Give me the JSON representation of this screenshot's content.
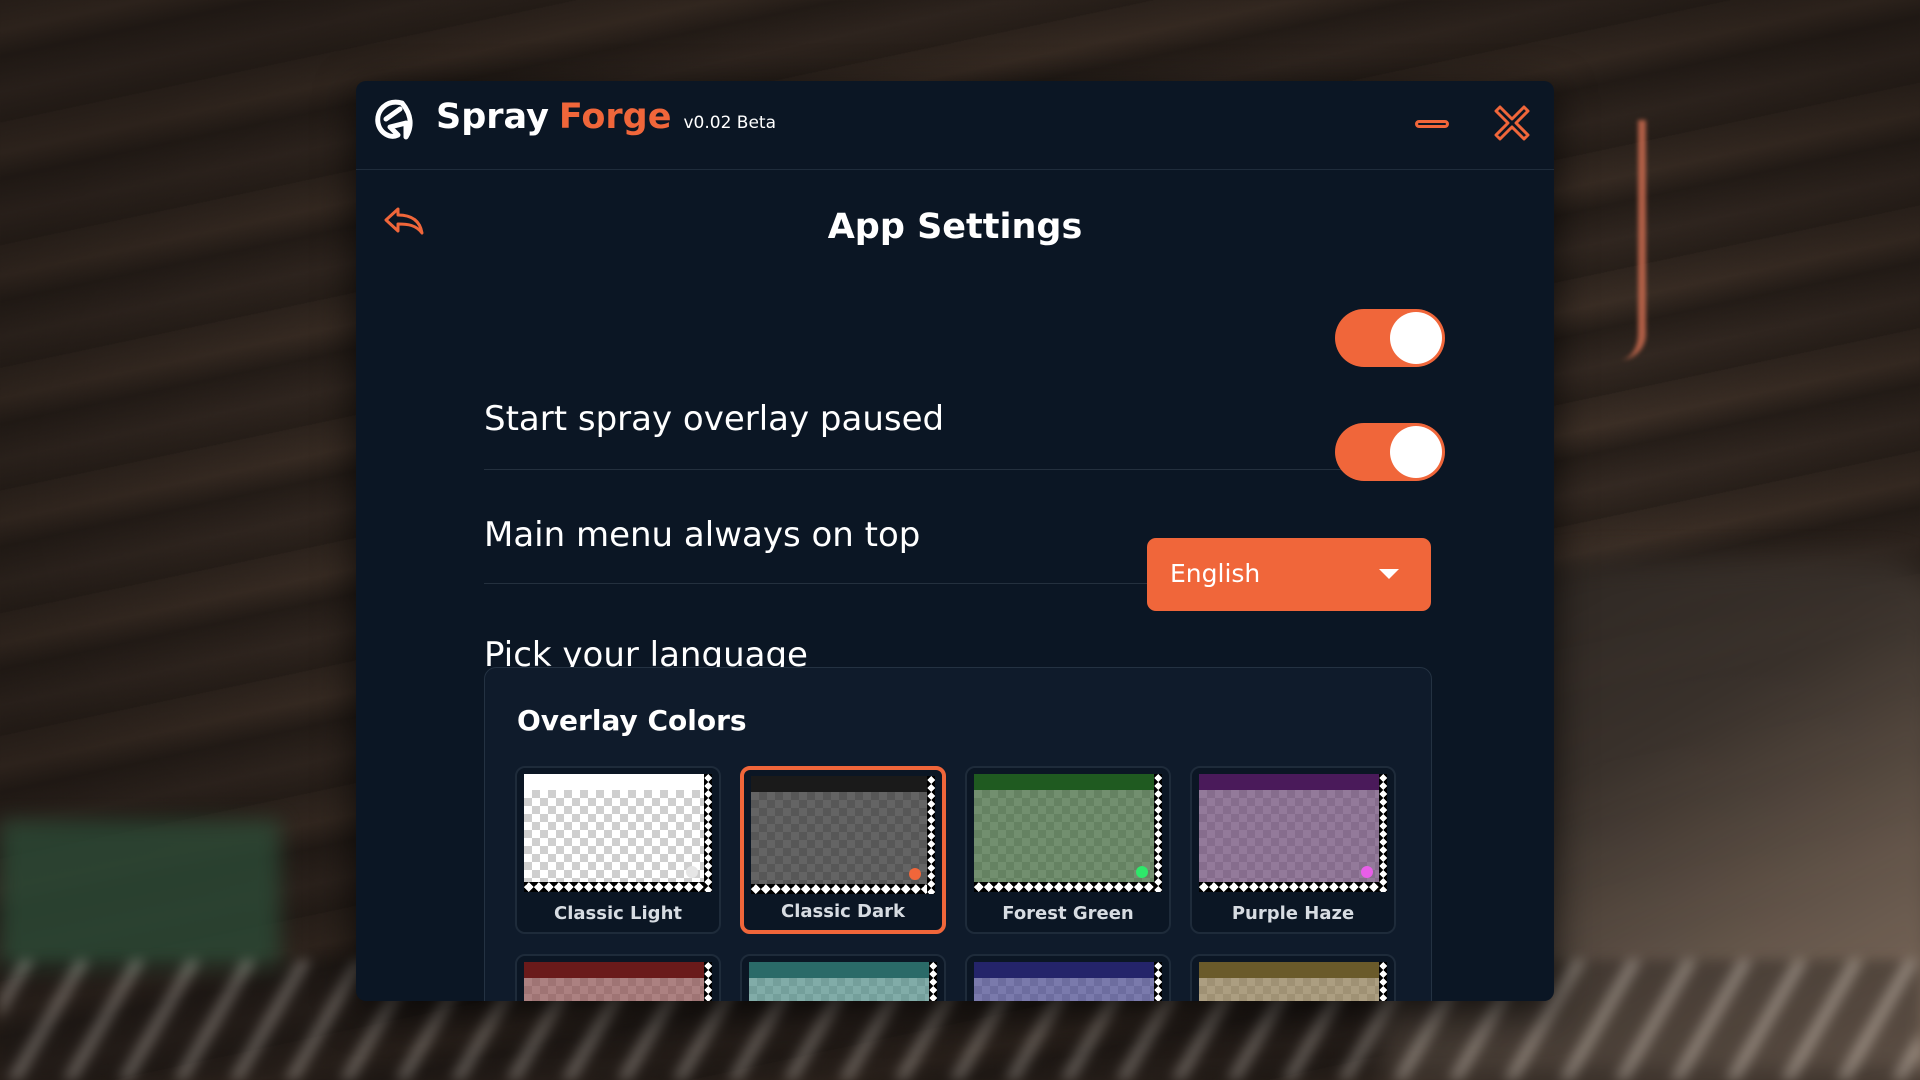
{
  "app": {
    "name_part1": "Spray",
    "name_part2": "Forge",
    "version": "v0.02 Beta",
    "accent_color": "#f0663a",
    "background_color": "#0b1624"
  },
  "window_controls": {
    "minimize_icon": "minimize-icon",
    "close_icon": "close-icon"
  },
  "page": {
    "title": "App Settings",
    "back_icon": "back-arrow-icon"
  },
  "settings": {
    "start_paused": {
      "label": "Start spray overlay paused",
      "enabled": true
    },
    "always_on_top": {
      "label": "Main menu always on top",
      "enabled": true
    },
    "language": {
      "label": "Pick your language",
      "selected": "English"
    }
  },
  "overlay_colors": {
    "title": "Overlay Colors",
    "selected": "Classic Dark",
    "swatches": [
      {
        "name": "Classic Light",
        "bar": "#ffffff",
        "tint": "rgba(255,255,255,0.0)",
        "dot": "#e6e6e6"
      },
      {
        "name": "Classic Dark",
        "bar": "#1a1a1a",
        "tint": "rgba(40,40,40,0.72)",
        "dot": "#f0663a"
      },
      {
        "name": "Forest Green",
        "bar": "#1f5a20",
        "tint": "rgba(60,100,55,0.72)",
        "dot": "#2ee86a"
      },
      {
        "name": "Purple Haze",
        "bar": "#4a1a5a",
        "tint": "rgba(105,70,115,0.72)",
        "dot": "#e85ee8"
      },
      {
        "name": "",
        "bar": "#6a1a1a",
        "tint": "rgba(140,80,80,0.72)",
        "dot": ""
      },
      {
        "name": "",
        "bar": "#2a6a68",
        "tint": "rgba(80,140,135,0.72)",
        "dot": ""
      },
      {
        "name": "",
        "bar": "#24246a",
        "tint": "rgba(70,70,140,0.72)",
        "dot": ""
      },
      {
        "name": "",
        "bar": "#6a5a2a",
        "tint": "rgba(140,120,80,0.72)",
        "dot": ""
      }
    ]
  }
}
